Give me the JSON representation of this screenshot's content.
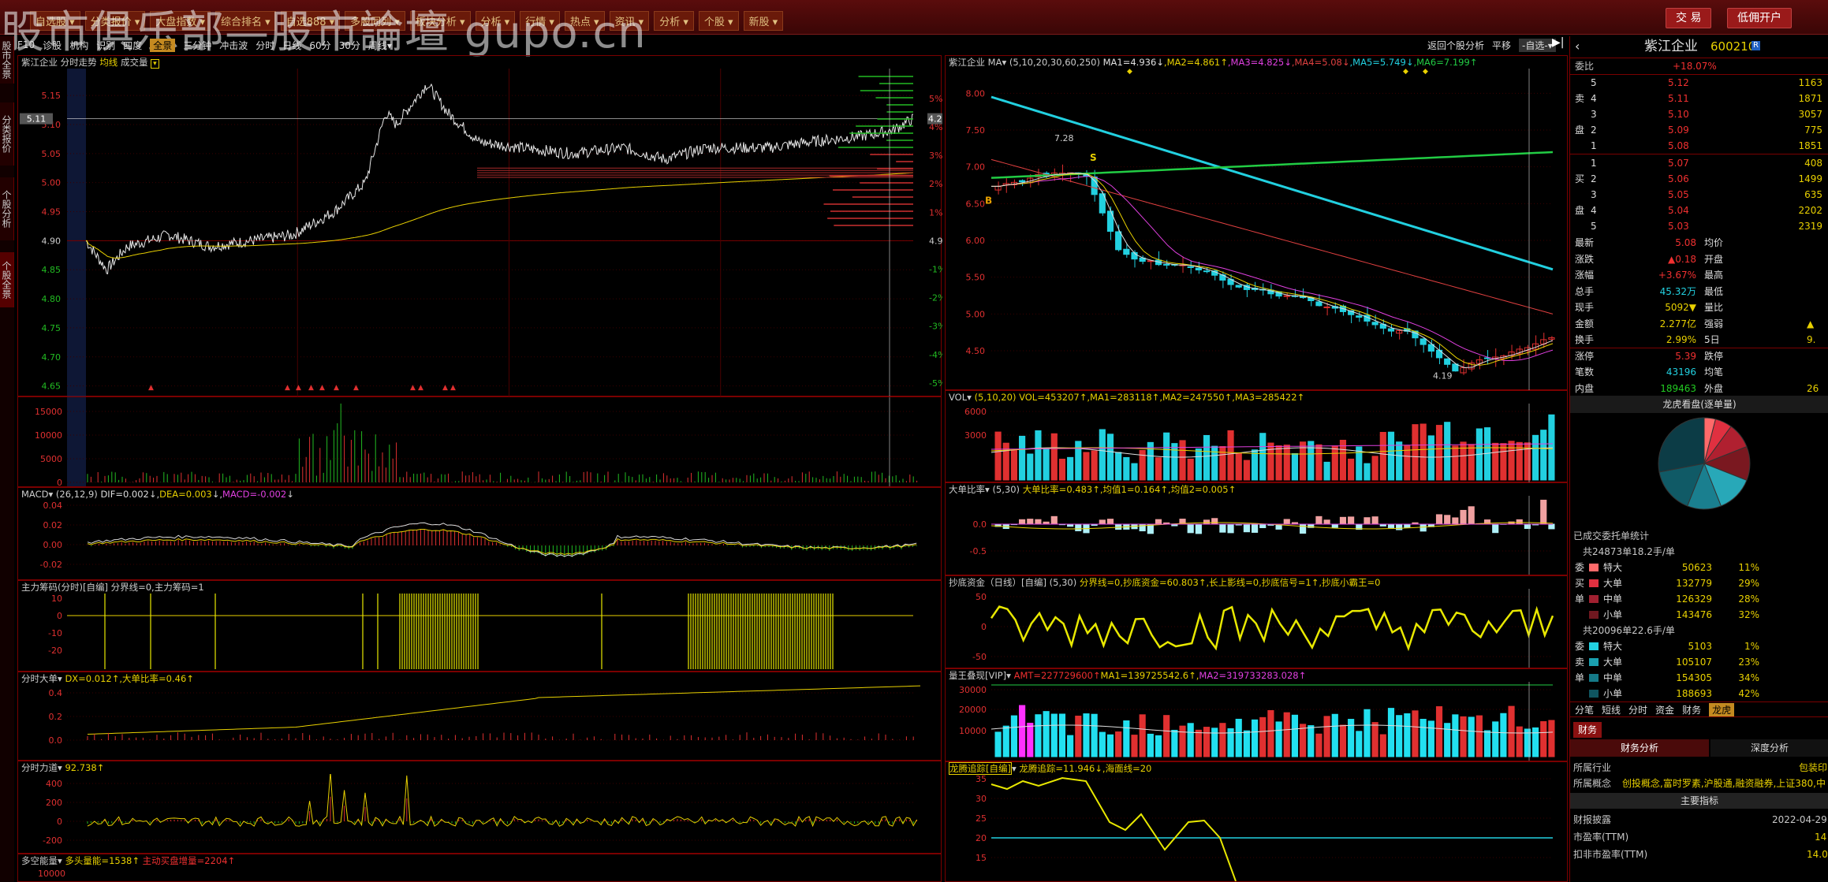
{
  "watermark": "股市俱乐部—股市論壇 gupo.cn",
  "top_menu": [
    "自选股",
    "分类报价",
    "大盘指数",
    "综合排名",
    "自选888",
    "多股同列",
    "板块分析",
    "分析",
    "行情",
    "热点",
    "资讯",
    "分析",
    "个股",
    "新股"
  ],
  "top_buttons": {
    "trade": "交 易",
    "margin": "低佣开户"
  },
  "sidebar_tabs": [
    "股市全景",
    "分类报价",
    "个股分析",
    "个股全景"
  ],
  "toolbar": {
    "items": [
      "F10",
      "诊股",
      "机构",
      "识别",
      "四度",
      "全景",
      "三分钟",
      "冲击波",
      "分时",
      "日线",
      "60分",
      "30分",
      "周线▾"
    ],
    "active": "全景",
    "right": [
      "返回个股分析",
      "平移",
      "-自选-▾"
    ]
  },
  "intraday": {
    "title_stock": "紫江企业",
    "title_mode": "分时走势",
    "title_avg": "均线",
    "title_vol": "成交量",
    "price_labels": [
      "5.15",
      "5.10",
      "5.05",
      "5.00",
      "4.95",
      "4.90",
      "4.85",
      "4.80",
      "4.75",
      "4.70",
      "4.65"
    ],
    "current_price_tag": "5.11",
    "current_pct_tag": "4.2%",
    "pct_labels": [
      "5%",
      "4%",
      "3%",
      "2%",
      "1%",
      "4.90",
      "-1%",
      "-2%",
      "-3%",
      "-4%",
      "-5%"
    ],
    "vol_labels": [
      "15000",
      "10000",
      "5000",
      "0"
    ],
    "macd": {
      "name": "MACD",
      "params": "(26,12,9)",
      "dif": "DIF=0.002",
      "dea": "DEA=0.003",
      "macd": "MACD=-0.002",
      "labels": [
        "0.04",
        "0.02",
        "0.00",
        "-0.02"
      ]
    },
    "zl": {
      "name": "主力筹码(分时)[自编]",
      "text": "分界线=0,主力筹码=1",
      "labels": [
        "10",
        "0",
        "-10",
        "-20"
      ]
    },
    "dd": {
      "name": "分时大单",
      "text": "DX=0.012↑,大单比率=0.46↑",
      "labels": [
        "0.4",
        "0.2",
        "0.0"
      ]
    },
    "fsll": {
      "name": "分时力道",
      "text": "92.738↑",
      "labels": [
        "400",
        "200",
        "0",
        "-200"
      ]
    },
    "dknl": {
      "name": "多空能量",
      "text": "多头量能=1538↑",
      "text2": "主动买盘增量=2204↑",
      "labels": [
        "10000"
      ]
    }
  },
  "daily": {
    "title_stock": "紫江企业",
    "ma_label": "MA",
    "ma_params": "(5,10,20,30,60,250)",
    "ma_vals": [
      {
        "t": "MA1=4.936↓",
        "c": "#e0e0e0"
      },
      {
        "t": "MA2=4.861↑",
        "c": "#e8d000"
      },
      {
        "t": "MA3=4.825↓",
        "c": "#e040e0"
      },
      {
        "t": "MA4=5.08↓",
        "c": "#e04040"
      },
      {
        "t": "MA5=5.749↓",
        "c": "#22d0e0"
      },
      {
        "t": "MA6=7.199↑",
        "c": "#22cc44"
      }
    ],
    "price_labels": [
      "8.00",
      "7.50",
      "7.00",
      "6.50",
      "6.00",
      "5.50",
      "5.00",
      "4.50"
    ],
    "annot_high": "7.28",
    "annot_low": "4.19",
    "annot_b": "B",
    "annot_s": "S",
    "vol": {
      "name": "VOL",
      "params": "(5,10,20)",
      "text": "VOL=453207↑,MA1=283118↑,MA2=247550↑,MA3=285422↑",
      "labels": [
        "6000",
        "3000"
      ]
    },
    "ddbl": {
      "name": "大单比率",
      "params": "(5,30)",
      "text": "大单比率=0.483↑,均值1=0.164↑,均值2=0.005↑",
      "labels": [
        "0.0",
        "-0.5"
      ]
    },
    "cdzj": {
      "name": "抄底资金（日线）[自编]",
      "params": "(5,30)",
      "text": "分界线=0,抄底资金=60.803↑,长上影线=0,抄底信号=1↑,抄底小霸王=0",
      "labels": [
        "50",
        "0",
        "-50"
      ]
    },
    "lwzx": {
      "name": "量王叠现[VIP]",
      "text1": "AMT=227729600↑",
      "text2": "MA1=139725542.6↑,",
      "text3": "MA2=319733283.028↑",
      "labels": [
        "30000",
        "20000",
        "10000"
      ]
    },
    "lthx": {
      "name": "龙腾追踪[自编]",
      "text": "龙腾追踪=11.946↓,海面线=20",
      "labels": [
        "35",
        "30",
        "25",
        "20",
        "15"
      ]
    }
  },
  "right": {
    "name": "紫江企业",
    "code": "600210",
    "badge": "R",
    "webi_label": "委比",
    "webi": "+18.07%",
    "sell": [
      {
        "lv": "5",
        "p": "5.12",
        "v": "1163"
      },
      {
        "lv": "4",
        "p": "5.11",
        "v": "1871"
      },
      {
        "lv": "3",
        "p": "5.10",
        "v": "3057"
      },
      {
        "lv": "2",
        "p": "5.09",
        "v": "775"
      },
      {
        "lv": "1",
        "p": "5.08",
        "v": "1851"
      }
    ],
    "buy": [
      {
        "lv": "1",
        "p": "5.07",
        "v": "408"
      },
      {
        "lv": "2",
        "p": "5.06",
        "v": "1499"
      },
      {
        "lv": "3",
        "p": "5.05",
        "v": "635"
      },
      {
        "lv": "4",
        "p": "5.04",
        "v": "2202"
      },
      {
        "lv": "5",
        "p": "5.03",
        "v": "2319"
      }
    ],
    "side_sell": "卖",
    "side_buy": "买",
    "side_pan": "盘",
    "quote": [
      {
        "l": "最新",
        "v": "5.08",
        "c": "red",
        "l2": "均价",
        "v2": ""
      },
      {
        "l": "涨跌",
        "v": "▲0.18",
        "c": "red",
        "l2": "开盘",
        "v2": ""
      },
      {
        "l": "涨幅",
        "v": "+3.67%",
        "c": "red",
        "l2": "最高",
        "v2": ""
      },
      {
        "l": "总手",
        "v": "45.32万",
        "c": "cyan",
        "l2": "最低",
        "v2": ""
      },
      {
        "l": "现手",
        "v": "5092▼",
        "c": "yel",
        "l2": "量比",
        "v2": ""
      },
      {
        "l": "金额",
        "v": "2.277亿",
        "c": "yel",
        "l2": "强弱",
        "v2": "▲"
      },
      {
        "l": "换手",
        "v": "2.99%",
        "c": "yel",
        "l2": "5日",
        "v2": "9."
      },
      {
        "l": "涨停",
        "v": "5.39",
        "c": "red",
        "l2": "跌停",
        "v2": ""
      },
      {
        "l": "笔数",
        "v": "43196",
        "c": "cyan",
        "l2": "均笔",
        "v2": ""
      },
      {
        "l": "内盘",
        "v": "189463",
        "c": "green",
        "l2": "外盘",
        "v2": "26"
      }
    ],
    "lh_title": "龙虎看盘(逐单量)",
    "pie": [
      {
        "v": 4,
        "c": "#ff6a6a"
      },
      {
        "v": 6,
        "c": "#e03040"
      },
      {
        "v": 9,
        "c": "#b02030"
      },
      {
        "v": 12,
        "c": "#7a1820"
      },
      {
        "v": 13,
        "c": "#28a8b8"
      },
      {
        "v": 12,
        "c": "#1a7f8f"
      },
      {
        "v": 16,
        "c": "#105a66"
      },
      {
        "v": 28,
        "c": "#0c3c46"
      }
    ],
    "stat_title": "已成交委托单统计",
    "buy_summary": "共24873单18.2手/单",
    "buy_rows": [
      {
        "n": "特大",
        "v": "50623",
        "p": "11%",
        "c": "#ff6a6a"
      },
      {
        "n": "大单",
        "v": "132779",
        "p": "29%",
        "c": "#e03040"
      },
      {
        "n": "中单",
        "v": "126329",
        "p": "28%",
        "c": "#a02030"
      },
      {
        "n": "小单",
        "v": "143476",
        "p": "32%",
        "c": "#701820"
      }
    ],
    "sell_summary": "共20096单22.6手/单",
    "sell_rows": [
      {
        "n": "特大",
        "v": "5103",
        "p": "1%",
        "c": "#22d0e0"
      },
      {
        "n": "大单",
        "v": "105107",
        "p": "23%",
        "c": "#1aa0b0"
      },
      {
        "n": "中单",
        "v": "154305",
        "p": "34%",
        "c": "#157a88"
      },
      {
        "n": "小单",
        "v": "188693",
        "p": "42%",
        "c": "#0f5560"
      }
    ],
    "side_wei": "委",
    "side_mai": "买",
    "side_dan": "单",
    "side_mai2": "卖",
    "tabs": [
      "分笔",
      "短线",
      "分时",
      "资金",
      "财务",
      "龙虎"
    ],
    "tab_active": "龙虎",
    "fin_tab": "财务",
    "fin_btns": [
      "财务分析",
      "深度分析"
    ],
    "industry_l": "所属行业",
    "industry_v": "包装印",
    "concept_l": "所属概念",
    "concept_v": "创投概念,富时罗素,沪股通,融资融券,上证380,中",
    "main_idx": "主要指标",
    "report_l": "财报披露",
    "report_v": "2022-04-29",
    "pe_l": "市盈率(TTM)",
    "pe_v": "14",
    "pe2_l": "扣非市盈率(TTM)",
    "pe2_v": "14.0"
  }
}
